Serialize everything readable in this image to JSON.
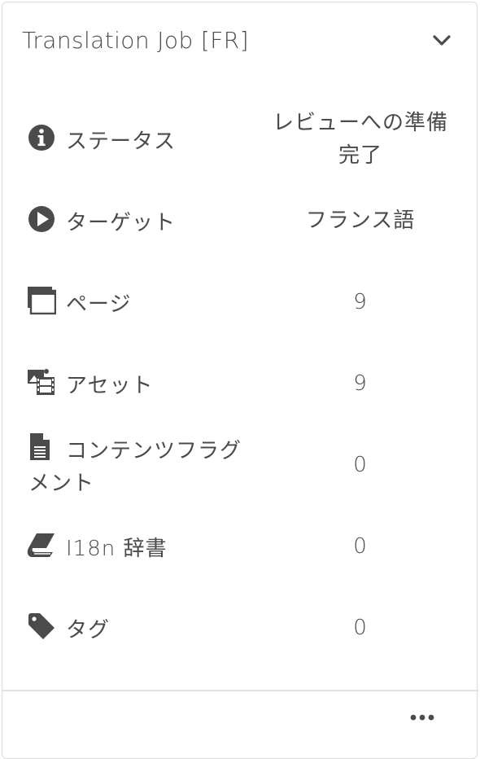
{
  "card": {
    "title": "Translation Job [FR]",
    "collapse_icon": "chevron-down-icon",
    "more_icon": "ellipsis-icon"
  },
  "rows": [
    {
      "icon": "info-icon",
      "label": "ステータス",
      "value_line1": "レビューへの準備",
      "value_line2": "完了"
    },
    {
      "icon": "play-icon",
      "label": "ターゲット",
      "value": "フランス語"
    },
    {
      "icon": "pages-icon",
      "label": "ページ",
      "value": "9"
    },
    {
      "icon": "assets-icon",
      "label": "アセット",
      "value": "9"
    },
    {
      "icon": "document-icon",
      "label_line1": "コンテンツフラグ",
      "label_line2": "メント",
      "value": "0"
    },
    {
      "icon": "dictionary-icon",
      "label": "I18n 辞書",
      "value": "0"
    },
    {
      "icon": "tag-icon",
      "label": "タグ",
      "value": "0"
    }
  ],
  "colors": {
    "text": "#4b4b4b",
    "icon": "#4b4b4b",
    "border": "#dcdcdc"
  }
}
